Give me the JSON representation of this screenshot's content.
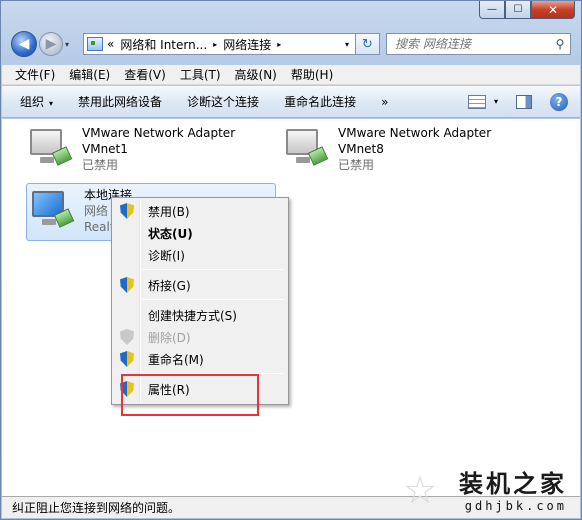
{
  "window": {
    "caption": {
      "minimize": "—",
      "maximize": "☐",
      "close": "✕"
    }
  },
  "nav": {
    "back_icon": "arrow-left",
    "forward_icon": "arrow-right",
    "dropdown": "▾"
  },
  "address": {
    "prefix": "«",
    "crumbs": [
      "网络和 Intern...",
      "网络连接"
    ],
    "separator": "▸",
    "dropdown": "▾",
    "refresh": "↻"
  },
  "search": {
    "placeholder": "搜索 网络连接",
    "icon": "🔍"
  },
  "menubar": {
    "items": [
      "文件(F)",
      "编辑(E)",
      "查看(V)",
      "工具(T)",
      "高级(N)",
      "帮助(H)"
    ]
  },
  "cmdbar": {
    "organize": "组织",
    "organize_arrow": "▾",
    "items": [
      "禁用此网络设备",
      "诊断这个连接",
      "重命名此连接"
    ],
    "more": "»",
    "view_arrow": "▾",
    "help": "?"
  },
  "adapters": [
    {
      "name": "VMware Network Adapter",
      "sub": "VMnet1",
      "status": "已禁用"
    },
    {
      "name": "VMware Network Adapter",
      "sub": "VMnet8",
      "status": "已禁用"
    },
    {
      "name": "本地连接",
      "sub": "网络",
      "status": "Realt"
    }
  ],
  "context_menu": {
    "items": [
      {
        "label": "禁用(B)",
        "shield": true
      },
      {
        "label": "状态(U)",
        "bold": true
      },
      {
        "label": "诊断(I)"
      },
      {
        "label": "桥接(G)",
        "shield": true
      },
      {
        "label": "创建快捷方式(S)"
      },
      {
        "label": "删除(D)",
        "shield": true,
        "disabled": true
      },
      {
        "label": "重命名(M)",
        "shield": true
      },
      {
        "label": "属性(R)",
        "shield": true
      }
    ]
  },
  "statusbar": {
    "text": "纠正阻止您连接到网络的问题。"
  },
  "watermark": {
    "title": "装机之家",
    "url": "gdhjbk.com"
  },
  "colors": {
    "highlight_box": "#e8333a",
    "selection": "#d2e5fa"
  }
}
